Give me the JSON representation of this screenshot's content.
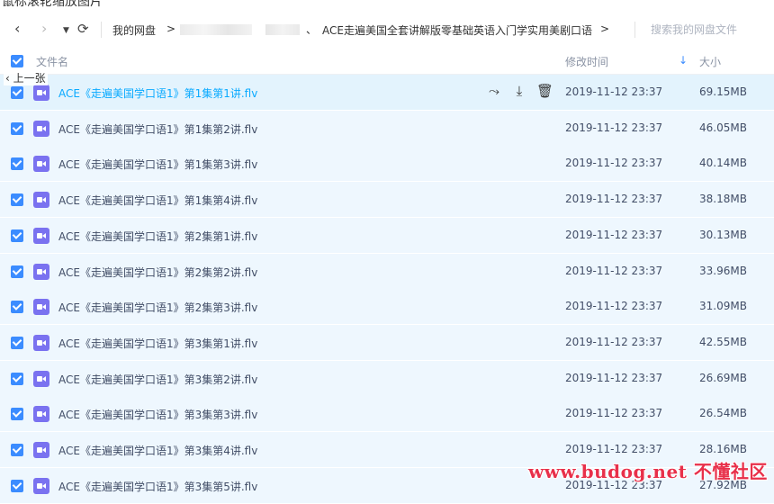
{
  "window": {
    "title_clipped": "鼠标滚轮缩放图片"
  },
  "nav": {
    "back_icon": "chevron-left-icon",
    "forward_icon": "chevron-right-icon",
    "dropdown_icon": "caret-down-icon",
    "refresh_icon": "refresh-icon",
    "crumbs": [
      "我的网盘",
      ">",
      "、",
      "ACE走遍美国全套讲解版零基础英语入门学实用美剧口语",
      ">"
    ],
    "search_placeholder": "搜索我的网盘文件"
  },
  "header": {
    "col_name": "文件名",
    "col_date": "修改时间",
    "col_size": "大小",
    "sort_indicator": "↓"
  },
  "overlay": {
    "prev_label": "上一张"
  },
  "files": [
    {
      "name": "ACE《走遍美国学口语1》第1集第1讲.flv",
      "date": "2019-11-12 23:37",
      "size": "69.15MB"
    },
    {
      "name": "ACE《走遍美国学口语1》第1集第2讲.flv",
      "date": "2019-11-12 23:37",
      "size": "46.05MB"
    },
    {
      "name": "ACE《走遍美国学口语1》第1集第3讲.flv",
      "date": "2019-11-12 23:37",
      "size": "40.14MB"
    },
    {
      "name": "ACE《走遍美国学口语1》第1集第4讲.flv",
      "date": "2019-11-12 23:37",
      "size": "38.18MB"
    },
    {
      "name": "ACE《走遍美国学口语1》第2集第1讲.flv",
      "date": "2019-11-12 23:37",
      "size": "30.13MB"
    },
    {
      "name": "ACE《走遍美国学口语1》第2集第2讲.flv",
      "date": "2019-11-12 23:37",
      "size": "33.96MB"
    },
    {
      "name": "ACE《走遍美国学口语1》第2集第3讲.flv",
      "date": "2019-11-12 23:37",
      "size": "31.09MB"
    },
    {
      "name": "ACE《走遍美国学口语1》第3集第1讲.flv",
      "date": "2019-11-12 23:37",
      "size": "42.55MB"
    },
    {
      "name": "ACE《走遍美国学口语1》第3集第2讲.flv",
      "date": "2019-11-12 23:37",
      "size": "26.69MB"
    },
    {
      "name": "ACE《走遍美国学口语1》第3集第3讲.flv",
      "date": "2019-11-12 23:37",
      "size": "26.54MB"
    },
    {
      "name": "ACE《走遍美国学口语1》第3集第4讲.flv",
      "date": "2019-11-12 23:37",
      "size": "28.16MB"
    },
    {
      "name": "ACE《走遍美国学口语1》第3集第5讲.flv",
      "date": "2019-11-12 23:37",
      "size": "27.92MB"
    }
  ],
  "row_actions": [
    "share-icon",
    "download-icon",
    "delete-icon"
  ],
  "watermark": "www.budog.net 不懂社区",
  "colors": {
    "accent": "#3b8cff",
    "link": "#09aaff",
    "row_bg": "#eef7fe",
    "video_icon": "#7a72f0",
    "watermark": "#e8304a"
  }
}
